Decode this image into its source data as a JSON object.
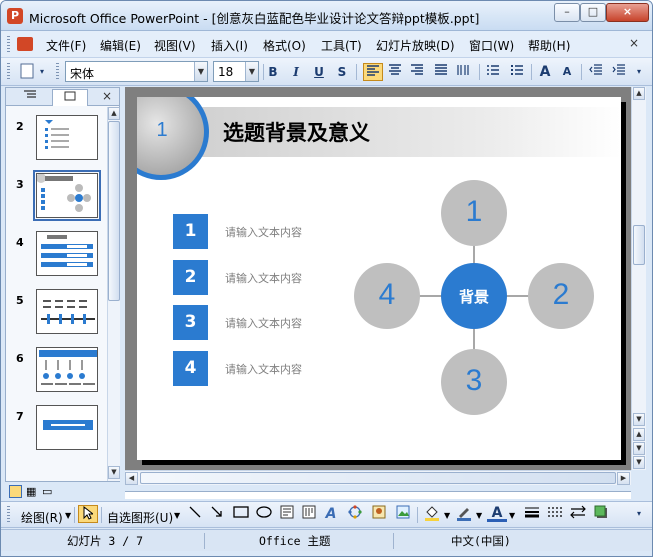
{
  "window": {
    "app_icon": "P",
    "title": "Microsoft Office PowerPoint - [创意灰白蓝配色毕业设计论文答辩ppt模板.ppt]",
    "min_label": "–",
    "max_label": "□",
    "close_label": "×"
  },
  "menu": {
    "items": [
      "文件(F)",
      "编辑(E)",
      "视图(V)",
      "插入(I)",
      "格式(O)",
      "工具(T)",
      "幻灯片放映(D)",
      "窗口(W)",
      "帮助(H)"
    ],
    "close_label": "×"
  },
  "toolbar": {
    "font_name": "宋体",
    "font_size": "18",
    "bold": "B",
    "italic": "I",
    "underline": "U",
    "shadow": "S",
    "increase_font": "A",
    "decrease_font": "A"
  },
  "pane": {
    "close_label": "×",
    "slide_numbers": [
      "2",
      "3",
      "4",
      "5",
      "6",
      "7"
    ],
    "selected_slide": "3"
  },
  "slide": {
    "badge_number": "1",
    "title": "选题背景及意义",
    "list": [
      {
        "num": "1",
        "text": "请输入文本内容"
      },
      {
        "num": "2",
        "text": "请输入文本内容"
      },
      {
        "num": "3",
        "text": "请输入文本内容"
      },
      {
        "num": "4",
        "text": "请输入文本内容"
      }
    ],
    "diagram": {
      "center": "背景",
      "top": "1",
      "right": "2",
      "bottom": "3",
      "left": "4"
    }
  },
  "drawbar": {
    "draw_label": "绘图(R)",
    "autoshapes_label": "自选图形(U)"
  },
  "status": {
    "slide_info": "幻灯片 3 / 7",
    "theme": "Office 主题",
    "language": "中文(中国)"
  },
  "colors": {
    "accent_blue": "#2b7bd0",
    "circle_gray": "#bfbfbf",
    "editor_gray": "#7f7f7f"
  }
}
